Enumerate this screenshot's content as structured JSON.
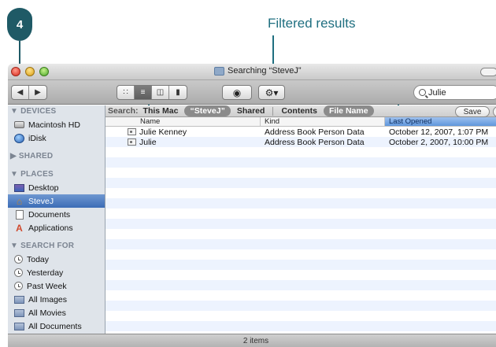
{
  "callouts": {
    "step": "4",
    "label": "Filtered results"
  },
  "window": {
    "title": "Searching “SteveJ”"
  },
  "toolbar": {
    "back_icon": "back-arrow",
    "forward_icon": "forward-arrow",
    "view_modes": [
      "icon-view",
      "list-view",
      "column-view",
      "coverflow-view"
    ],
    "active_view": "list-view",
    "quicklook_icon": "eye",
    "action_icon": "gear",
    "search_value": "Julie"
  },
  "sidebar": {
    "sections": [
      {
        "heading": "▼ DEVICES",
        "items": [
          {
            "label": "Macintosh HD",
            "icon": "disk-icon"
          },
          {
            "label": "iDisk",
            "icon": "idisk-icon"
          }
        ]
      },
      {
        "heading": "▶ SHARED",
        "items": []
      },
      {
        "heading": "▼ PLACES",
        "items": [
          {
            "label": "Desktop",
            "icon": "desktop-icon"
          },
          {
            "label": "SteveJ",
            "icon": "home-icon",
            "selected": true
          },
          {
            "label": "Documents",
            "icon": "documents-icon"
          },
          {
            "label": "Applications",
            "icon": "applications-icon"
          }
        ]
      },
      {
        "heading": "▼ SEARCH FOR",
        "items": [
          {
            "label": "Today",
            "icon": "clock-icon"
          },
          {
            "label": "Yesterday",
            "icon": "clock-icon"
          },
          {
            "label": "Past Week",
            "icon": "clock-icon"
          },
          {
            "label": "All Images",
            "icon": "smart-folder-icon"
          },
          {
            "label": "All Movies",
            "icon": "smart-folder-icon"
          },
          {
            "label": "All Documents",
            "icon": "smart-folder-icon"
          }
        ]
      }
    ]
  },
  "scope": {
    "label": "Search:",
    "this_mac": "This Mac",
    "steve": "“SteveJ”",
    "shared": "Shared",
    "contents": "Contents",
    "file_name": "File Name",
    "save": "Save",
    "plus": "+"
  },
  "columns": {
    "name": "Name",
    "kind": "Kind",
    "last_opened": "Last Opened"
  },
  "results": [
    {
      "name": "Julie Kenney",
      "kind": "Address Book Person Data",
      "last_opened": "October 12, 2007, 1:07 PM"
    },
    {
      "name": "Julie",
      "kind": "Address Book Person Data",
      "last_opened": "October 2, 2007, 10:00 PM"
    }
  ],
  "status": {
    "text": "2 items"
  }
}
